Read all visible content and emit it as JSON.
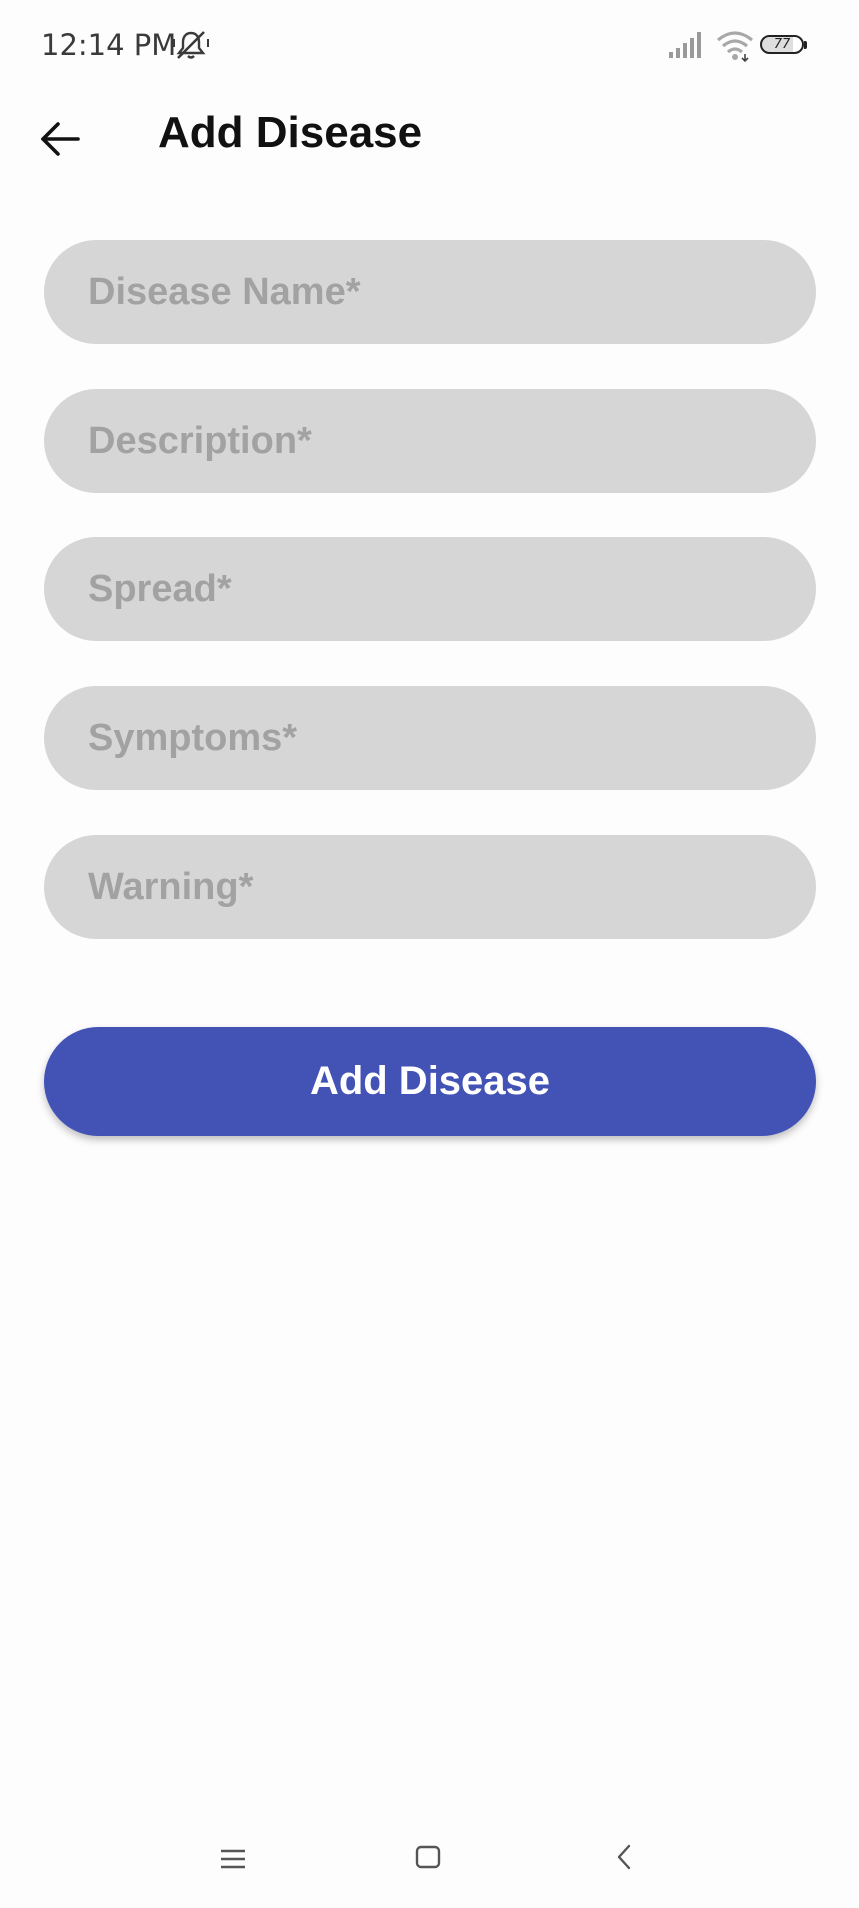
{
  "status_bar": {
    "time": "12:14 PM",
    "battery_level": "77",
    "battery_fraction": 0.77,
    "icons": [
      "mute-icon",
      "signal-icon",
      "wifi-icon",
      "battery-icon"
    ]
  },
  "app_bar": {
    "title": "Add Disease",
    "back_icon": "arrow-left-icon"
  },
  "form": {
    "fields": [
      {
        "name": "disease-name-input",
        "placeholder": "Disease Name*",
        "value": ""
      },
      {
        "name": "description-input",
        "placeholder": "Description*",
        "value": ""
      },
      {
        "name": "spread-input",
        "placeholder": "Spread*",
        "value": ""
      },
      {
        "name": "symptoms-input",
        "placeholder": "Symptoms*",
        "value": ""
      },
      {
        "name": "warning-input",
        "placeholder": "Warning*",
        "value": ""
      }
    ],
    "submit_label": "Add Disease"
  },
  "nav_bar": {
    "icons": [
      "menu-icon",
      "home-icon",
      "back-icon"
    ]
  },
  "colors": {
    "accent": "#4252b5",
    "field_bg": "#d7d6d7",
    "placeholder": "#a3a2a3",
    "background": "#fefdfe"
  }
}
